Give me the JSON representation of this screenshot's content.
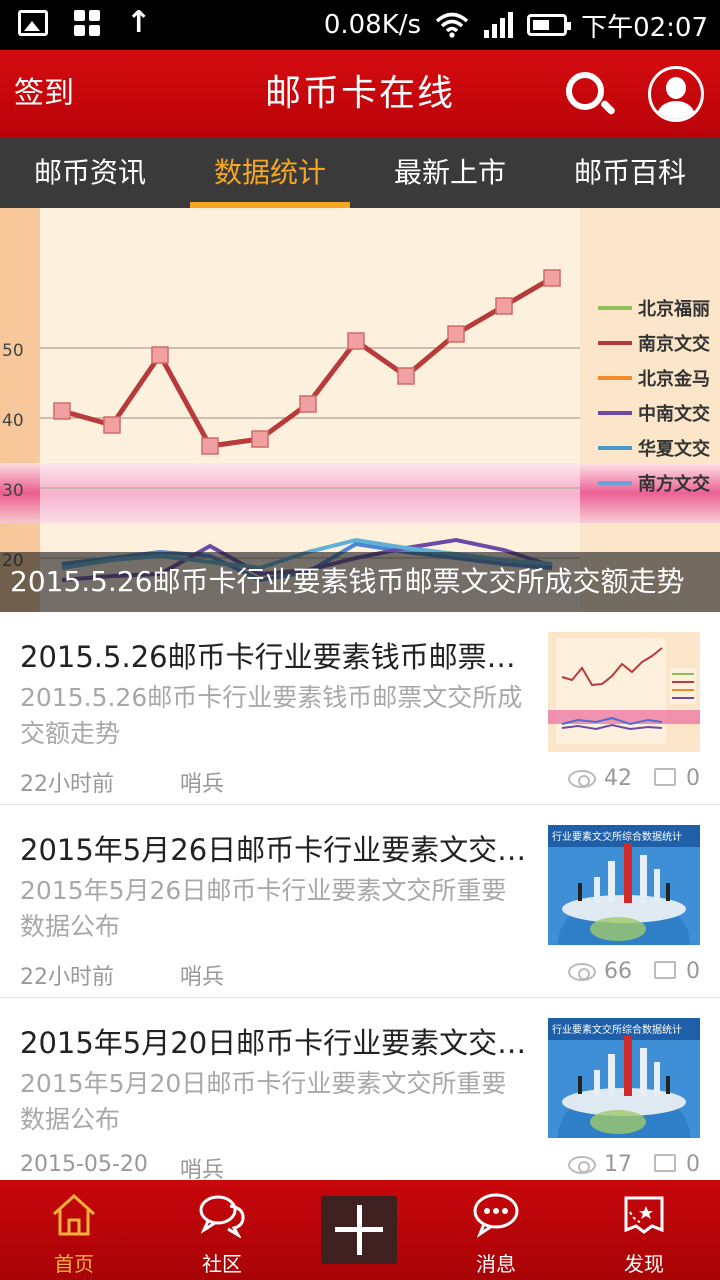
{
  "status_bar": {
    "speed": "0.08K/s",
    "time": "下午02:07"
  },
  "header": {
    "signin": "签到",
    "title": "邮币卡在线"
  },
  "tabs": [
    {
      "label": "邮币资讯"
    },
    {
      "label": "数据统计"
    },
    {
      "label": "最新上市"
    },
    {
      "label": "邮币百科"
    }
  ],
  "active_tab": "数据统计",
  "banner": {
    "caption": "2015.5.26邮币卡行业要素钱币邮票文交所成交额走势",
    "chart_data": {
      "type": "line",
      "y_ticks": [
        "20",
        "30",
        "40",
        "50"
      ],
      "legend": [
        "北京福丽",
        "南京文交",
        "北京金马",
        "中南文交",
        "华夏文交",
        "南方文交"
      ],
      "series": [
        {
          "name": "南京文交",
          "values": [
            41,
            39,
            49,
            36,
            37,
            42,
            51,
            46,
            52,
            56,
            60
          ]
        }
      ]
    }
  },
  "articles": [
    {
      "title": "2015.5.26邮币卡行业要素钱币邮票文交所成交额走势",
      "summary": "2015.5.26邮币卡行业要素钱币邮票文交所成交额走势",
      "time": "22小时前",
      "author": "哨兵",
      "views": "42",
      "comments": "0",
      "thumb": "chart"
    },
    {
      "title": "2015年5月26日邮币卡行业要素文交所重要数据公布",
      "summary": "2015年5月26日邮币卡行业要素文交所重要数据公布",
      "time": "22小时前",
      "author": "哨兵",
      "views": "66",
      "comments": "0",
      "thumb": "globe",
      "thumb_text": "行业要素文交所综合数据统计"
    },
    {
      "title": "2015年5月20日邮币卡行业要素文交所重要数据公布",
      "summary": "2015年5月20日邮币卡行业要素文交所重要数据公布",
      "time": "2015-05-20",
      "author": "哨兵",
      "views": "17",
      "comments": "0",
      "thumb": "globe",
      "thumb_text": "行业要素文交所综合数据统计"
    }
  ],
  "bottom_nav": [
    {
      "label": "首页",
      "icon": "home-icon"
    },
    {
      "label": "社区",
      "icon": "community-icon"
    },
    {
      "label": "",
      "icon": "plus-icon"
    },
    {
      "label": "消息",
      "icon": "message-icon"
    },
    {
      "label": "发现",
      "icon": "discover-icon"
    }
  ],
  "colors": {
    "header_red": "#c8070b",
    "tab_bar": "#3a3a3a",
    "accent_orange": "#f5a623"
  }
}
